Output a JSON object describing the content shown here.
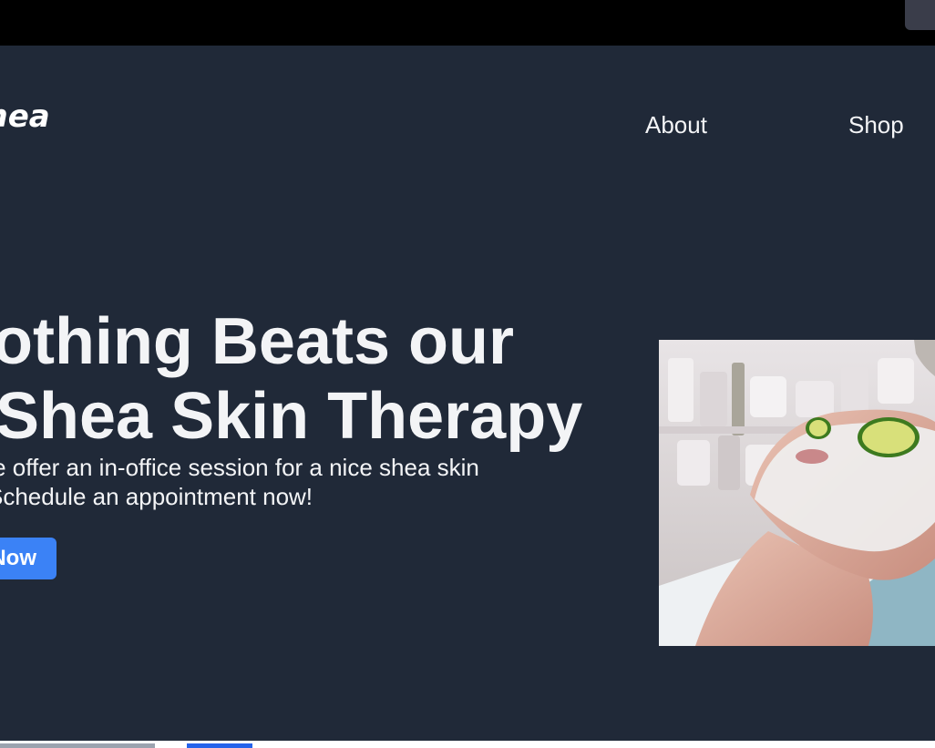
{
  "brand": {
    "logo_text": "Shea"
  },
  "nav": {
    "items": [
      {
        "label": "About"
      },
      {
        "label": "Shop"
      }
    ]
  },
  "hero": {
    "title_line1": "Nothing Beats our",
    "title_line2": "Shea Skin Therapy",
    "text_line1": "We offer an in-office session for a nice shea skin",
    "text_line2": "Schedule an appointment now!",
    "cta_label": "Book Now",
    "image_alt": "Woman receiving a facial mask treatment with cucumber slices over her eyes"
  },
  "colors": {
    "background": "#202938",
    "accent": "#3b82f6",
    "text": "#f3f4f6"
  }
}
